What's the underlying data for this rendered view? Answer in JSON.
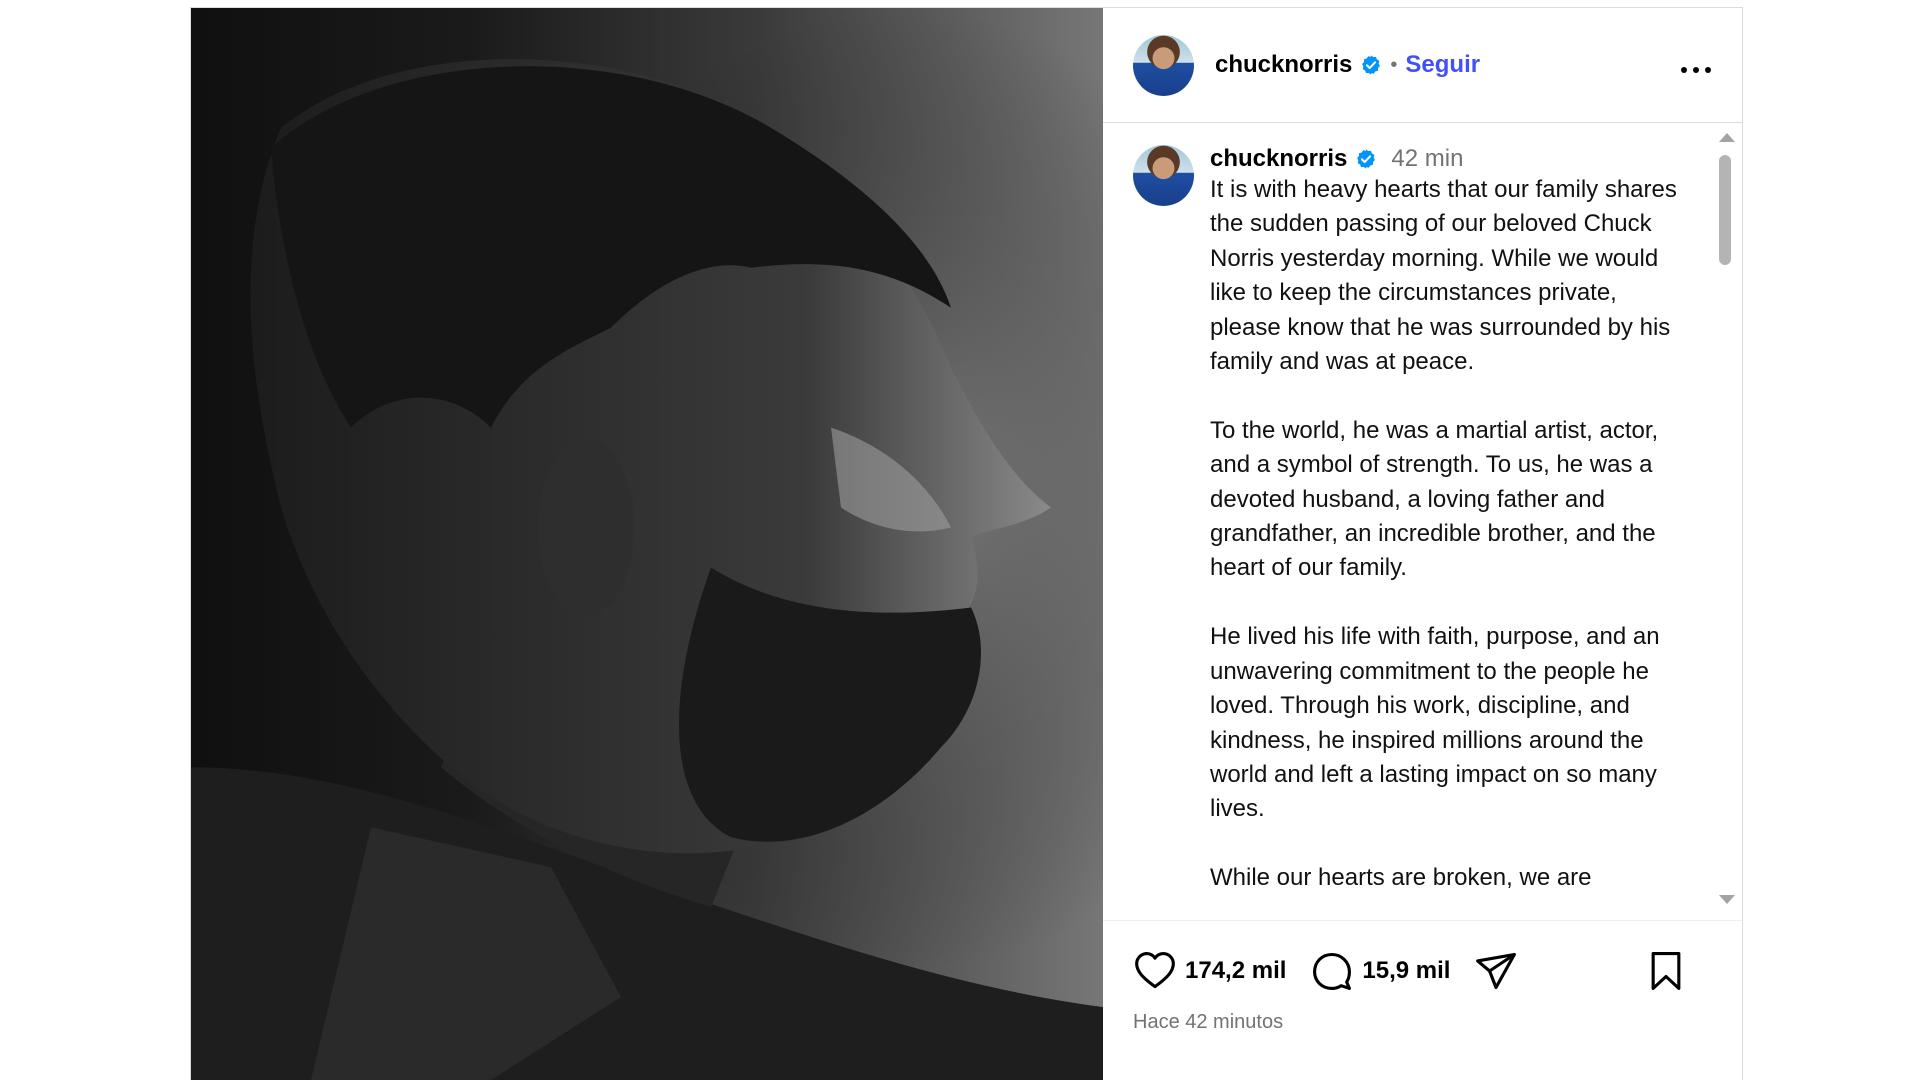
{
  "post": {
    "photo_alt": "black-and-white profile portrait",
    "header": {
      "username": "chucknorris",
      "separator": "•",
      "follow_label": "Seguir",
      "more_icon": "more-horizontal-icon"
    },
    "caption": {
      "username": "chucknorris",
      "time": "42 min",
      "text": "It is with heavy hearts that our family shares the sudden passing of our beloved Chuck Norris yesterday morning. While we would like to keep the circumstances private, please know that he was surrounded by his family and was at peace.\n\nTo the world, he was a martial artist, actor, and a symbol of strength. To us, he was a devoted husband, a loving father and grandfather, an incredible brother, and the heart of our family.\n\nHe lived his life with faith, purpose, and an unwavering commitment to the people he loved. Through his work, discipline, and kindness, he inspired millions around the world and left a lasting impact on so many lives.\n\nWhile our hearts are broken, we are"
    },
    "footer": {
      "likes": "174,2 mil",
      "comments": "15,9 mil",
      "timestamp": "Hace 42 minutos"
    }
  },
  "colors": {
    "accent": "#4150f7",
    "verified": "#0095f6",
    "muted": "#737373",
    "border": "#dbdbdb"
  }
}
